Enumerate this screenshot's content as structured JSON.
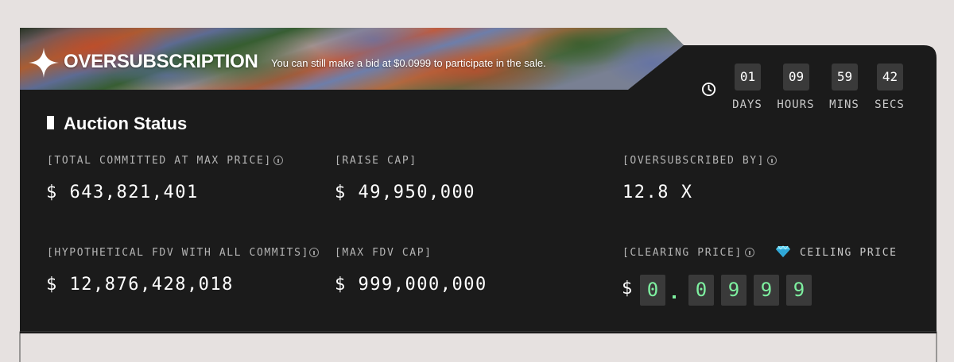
{
  "banner": {
    "title": "OVERSUBSCRIPTION",
    "subtitle": "You can still make a bid at $0.0999 to participate in the sale.",
    "icon": "sparkle-star-icon"
  },
  "countdown": {
    "icon": "clock-icon",
    "days": {
      "value": "01",
      "label": "DAYS"
    },
    "hours": {
      "value": "09",
      "label": "HOURS"
    },
    "mins": {
      "value": "59",
      "label": "MINS"
    },
    "secs": {
      "value": "42",
      "label": "SECS"
    }
  },
  "auction": {
    "title": "Auction Status",
    "total_committed": {
      "label": "[TOTAL COMMITTED AT MAX PRICE]",
      "value": "$ 643,821,401"
    },
    "raise_cap": {
      "label": "[RAISE CAP]",
      "value": "$ 49,950,000"
    },
    "oversubscribed_by": {
      "label": "[OVERSUBSCRIBED BY]",
      "value": "12.8 X"
    },
    "hypothetical_fdv": {
      "label": "[HYPOTHETICAL FDV WITH ALL COMMITS]",
      "value": "$ 12,876,428,018"
    },
    "max_fdv_cap": {
      "label": "[MAX FDV CAP]",
      "value": "$ 999,000,000"
    },
    "clearing_price": {
      "label": "[CLEARING PRICE]",
      "ceiling_label": "CEILING PRICE",
      "currency": "$",
      "digits": [
        "0",
        "0",
        "9",
        "9",
        "9"
      ],
      "digit_color": "#7ef0a0"
    }
  },
  "colors": {
    "panel": "#1b1b1b",
    "page_bg": "#e6e1e0",
    "accent_green": "#7ef0a0"
  }
}
